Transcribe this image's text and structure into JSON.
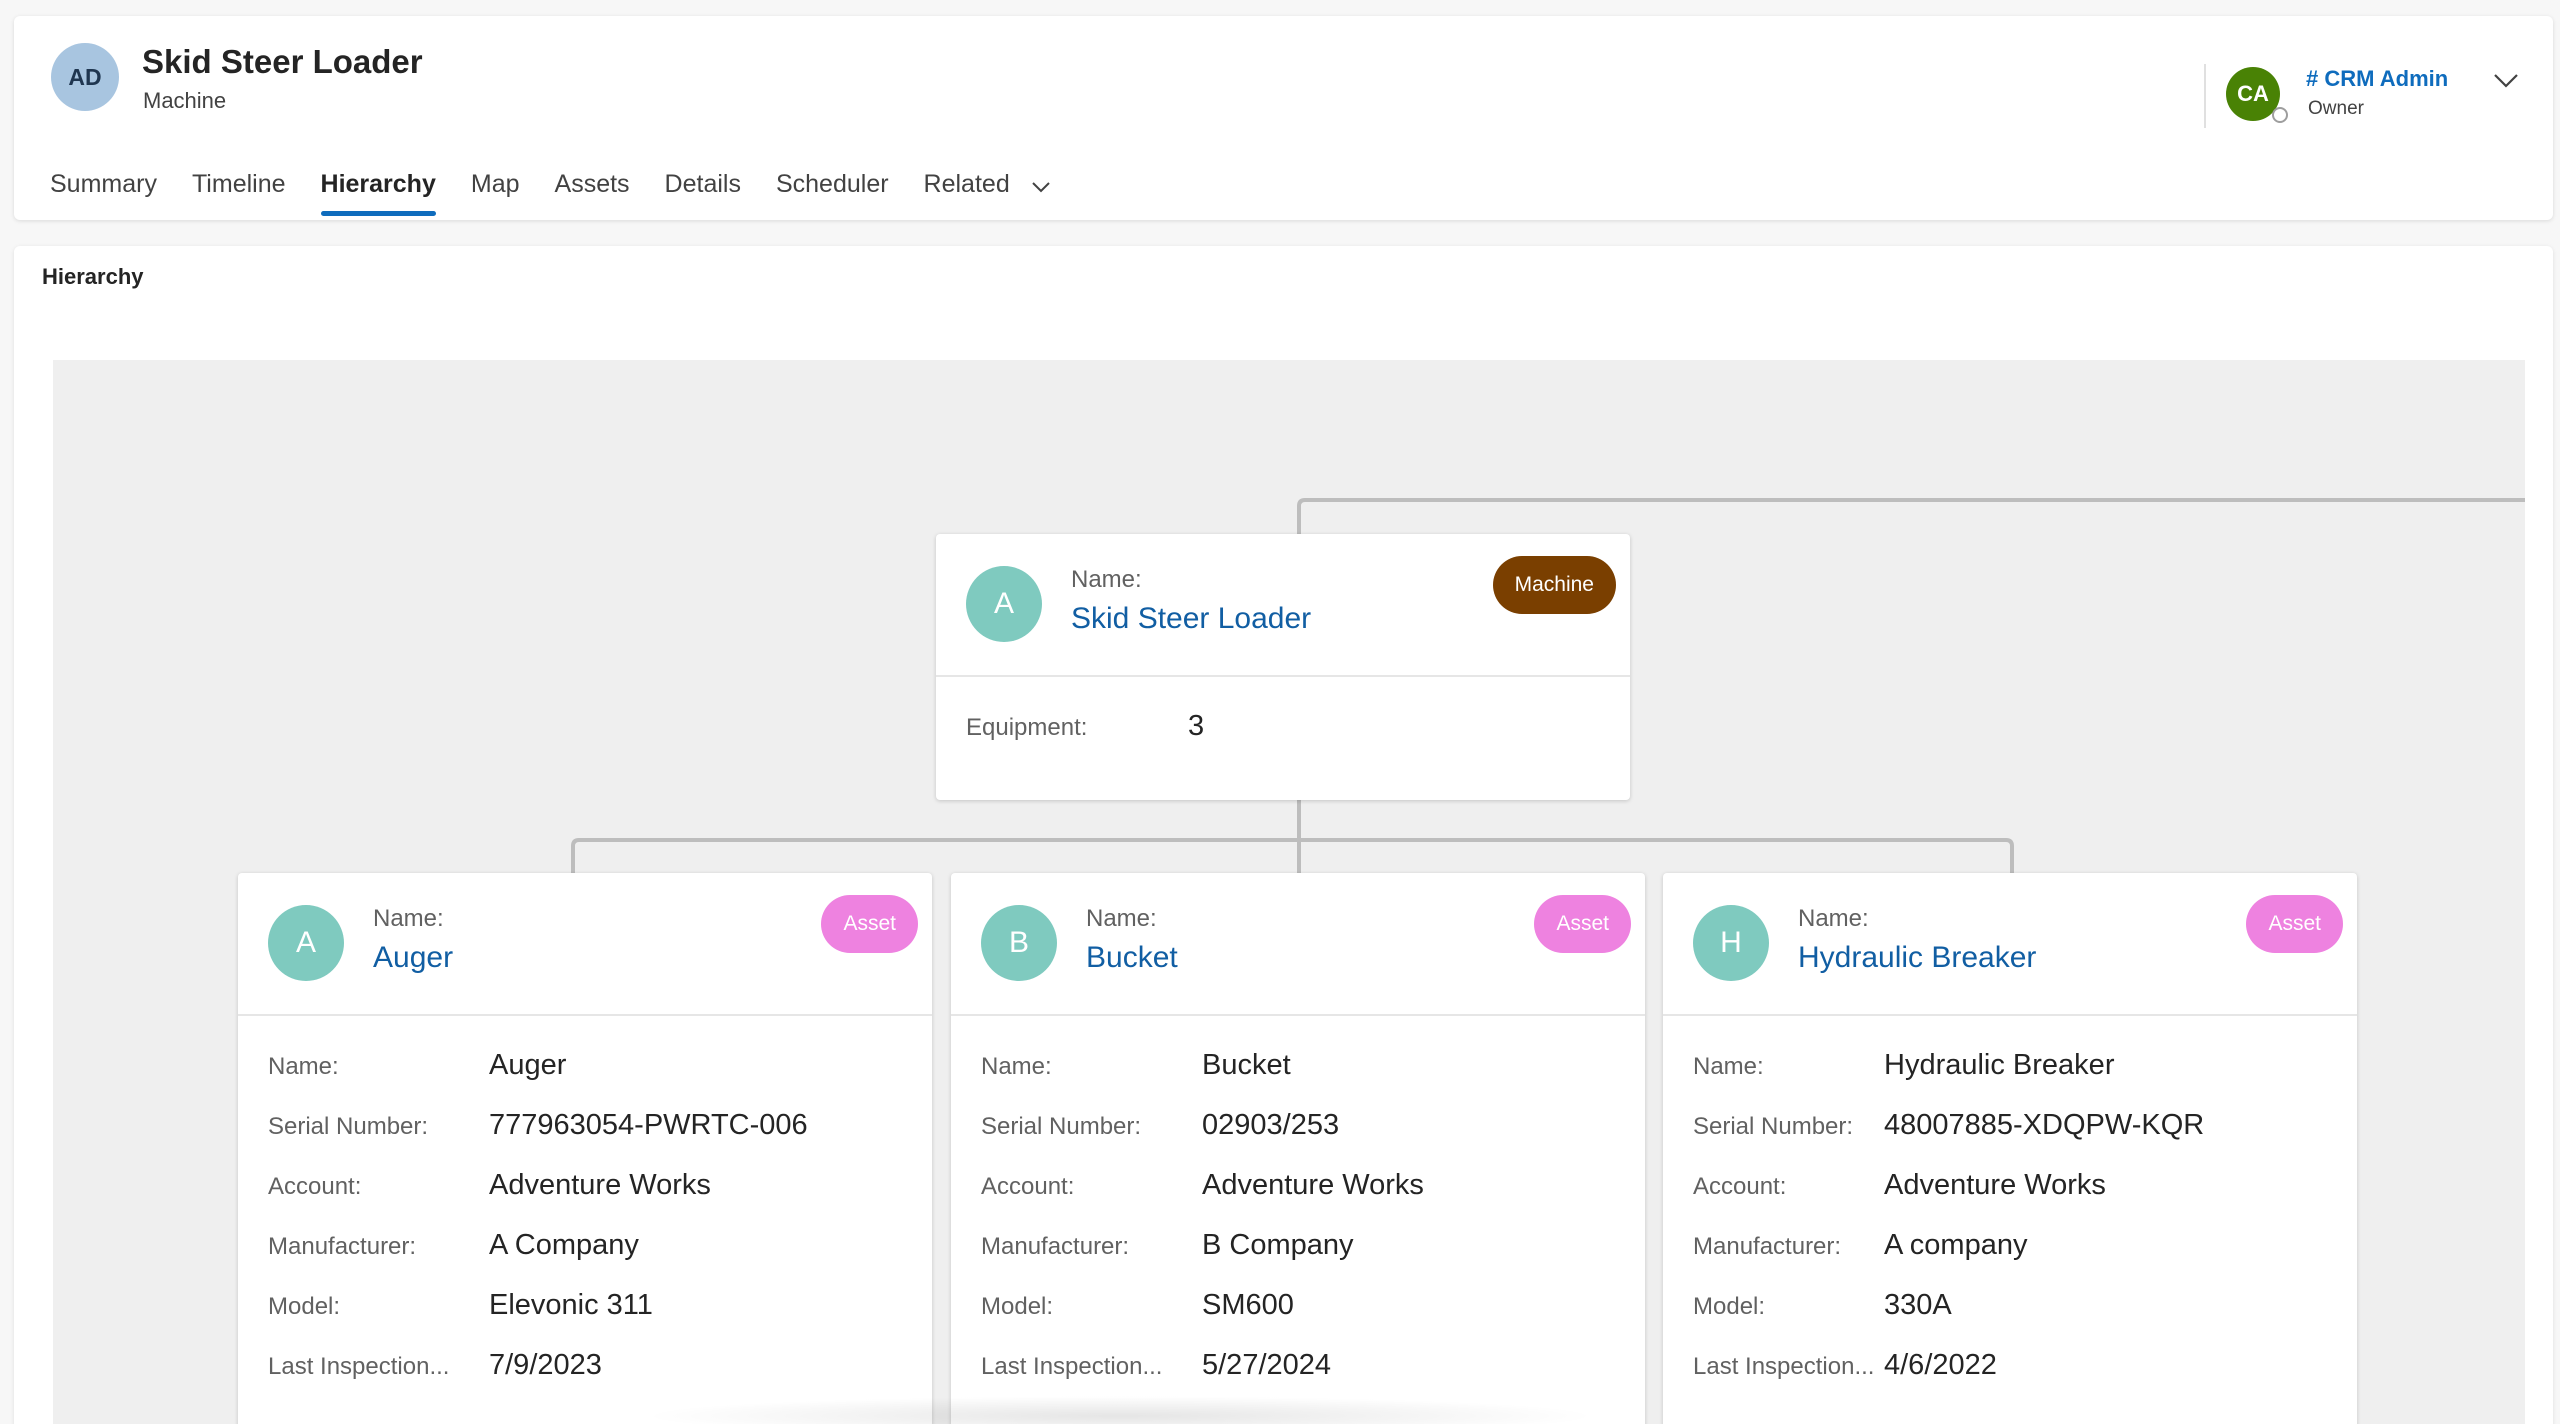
{
  "header": {
    "avatar_initials": "AD",
    "title": "Skid Steer Loader",
    "subtitle": "Machine",
    "tabs": [
      {
        "label": "Summary"
      },
      {
        "label": "Timeline"
      },
      {
        "label": "Hierarchy",
        "active": true
      },
      {
        "label": "Map"
      },
      {
        "label": "Assets"
      },
      {
        "label": "Details"
      },
      {
        "label": "Scheduler"
      },
      {
        "label": "Related",
        "has_dropdown": true
      }
    ],
    "owner": {
      "initials": "CA",
      "name": "# CRM Admin",
      "role": "Owner"
    }
  },
  "section": {
    "title": "Hierarchy"
  },
  "root": {
    "initial": "A",
    "name_label": "Name:",
    "name": "Skid Steer Loader",
    "badge": "Machine",
    "fields": [
      {
        "label": "Equipment:",
        "value": "3"
      }
    ]
  },
  "children": [
    {
      "initial": "A",
      "name_label": "Name:",
      "name": "Auger",
      "badge": "Asset",
      "fields": [
        {
          "label": "Name:",
          "value": "Auger"
        },
        {
          "label": "Serial Number:",
          "value": "777963054-PWRTC-006"
        },
        {
          "label": "Account:",
          "value": "Adventure Works"
        },
        {
          "label": "Manufacturer:",
          "value": "A Company"
        },
        {
          "label": "Model:",
          "value": "Elevonic 311"
        },
        {
          "label": "Last Inspection...",
          "value": "7/9/2023"
        }
      ]
    },
    {
      "initial": "B",
      "name_label": "Name:",
      "name": "Bucket",
      "badge": "Asset",
      "fields": [
        {
          "label": "Name:",
          "value": "Bucket"
        },
        {
          "label": "Serial Number:",
          "value": "02903/253"
        },
        {
          "label": "Account:",
          "value": "Adventure Works"
        },
        {
          "label": "Manufacturer:",
          "value": "B Company"
        },
        {
          "label": "Model:",
          "value": "SM600"
        },
        {
          "label": "Last Inspection...",
          "value": "5/27/2024"
        }
      ]
    },
    {
      "initial": "H",
      "name_label": "Name:",
      "name": "Hydraulic Breaker",
      "badge": "Asset",
      "fields": [
        {
          "label": "Name:",
          "value": "Hydraulic Breaker"
        },
        {
          "label": "Serial Number:",
          "value": "48007885-XDQPW-KQR"
        },
        {
          "label": "Account:",
          "value": "Adventure Works"
        },
        {
          "label": "Manufacturer:",
          "value": "A company"
        },
        {
          "label": "Model:",
          "value": "330A"
        },
        {
          "label": "Last Inspection...",
          "value": "4/6/2022"
        }
      ]
    }
  ],
  "colors": {
    "accent": "#0f6cbd",
    "link": "#115ea3",
    "machine_badge": "#7a3f00",
    "asset_badge": "#ee82e0",
    "node_avatar": "#7fcabf",
    "owner_avatar": "#498205"
  }
}
